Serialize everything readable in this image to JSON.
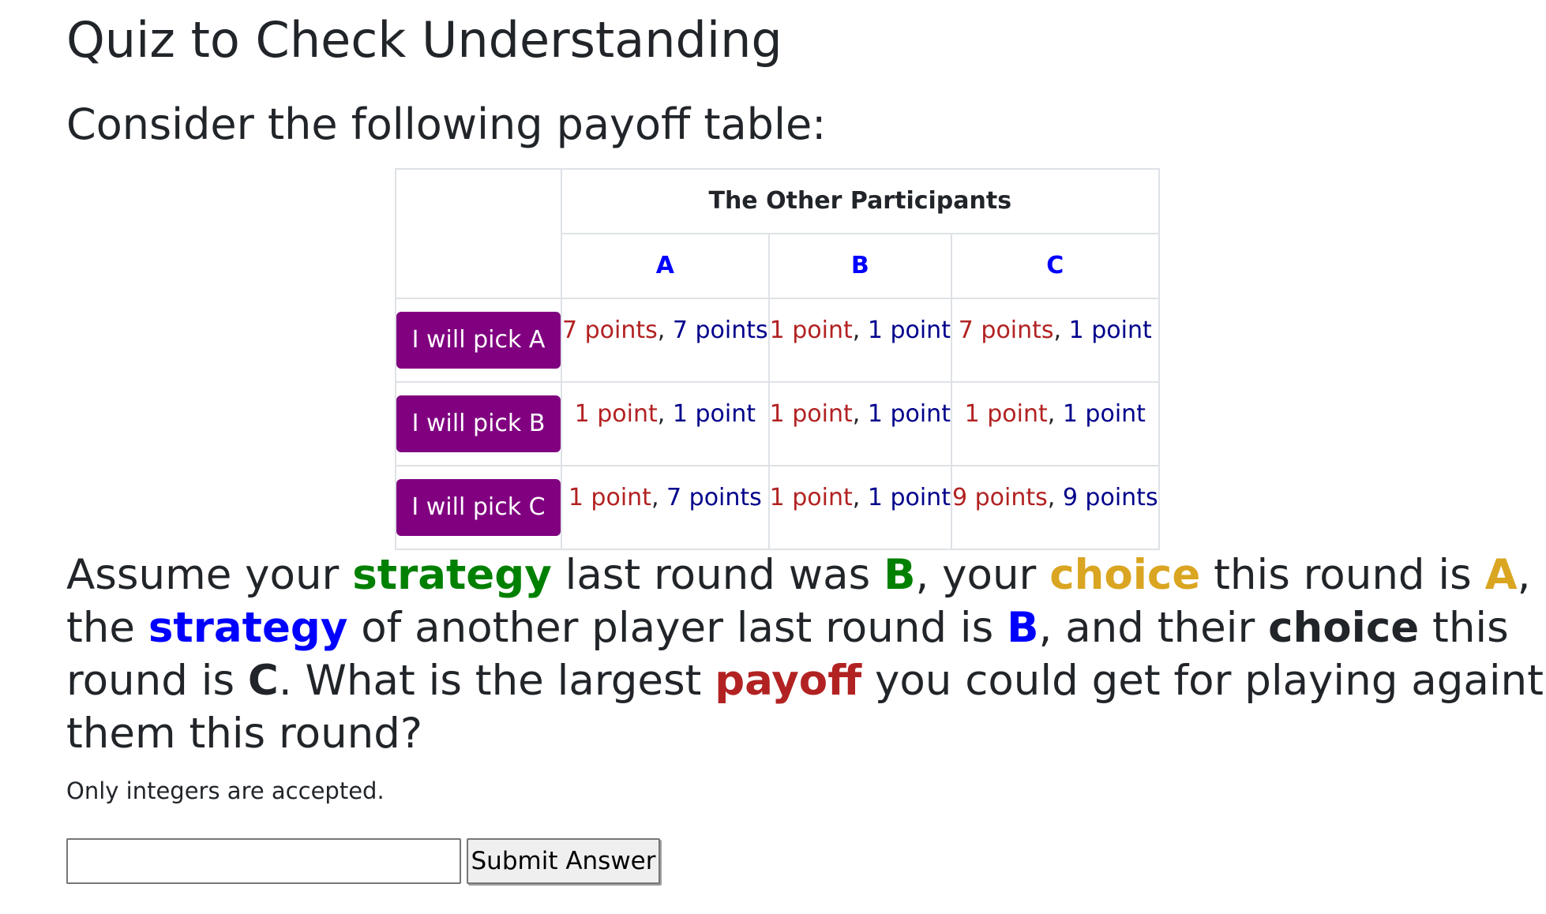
{
  "page": {
    "title": "Quiz to Check Understanding",
    "subtitle": "Consider the following payoff table:"
  },
  "table": {
    "group_header": "The Other Participants",
    "columns": [
      "A",
      "B",
      "C"
    ],
    "rows": [
      {
        "button": "I will pick A",
        "cells": [
          {
            "mine": "7 points",
            "theirs": "7 points"
          },
          {
            "mine": "1 point",
            "theirs": "1 point"
          },
          {
            "mine": "7 points",
            "theirs": "1 point"
          }
        ]
      },
      {
        "button": "I will pick B",
        "cells": [
          {
            "mine": "1 point",
            "theirs": "1 point"
          },
          {
            "mine": "1 point",
            "theirs": "1 point"
          },
          {
            "mine": "1 point",
            "theirs": "1 point"
          }
        ]
      },
      {
        "button": "I will pick C",
        "cells": [
          {
            "mine": "1 point",
            "theirs": "7 points"
          },
          {
            "mine": "1 point",
            "theirs": "1 point"
          },
          {
            "mine": "9 points",
            "theirs": "9 points"
          }
        ]
      }
    ],
    "separator": ", "
  },
  "question": {
    "t1": "Assume your ",
    "k1": "strategy",
    "t2": " last round was ",
    "k2": "B",
    "t3": ", your ",
    "k3": "choice",
    "t4": " this round is ",
    "k4": "A",
    "t5": ", the ",
    "k5": "strategy",
    "t6": " of another player last round is ",
    "k6": "B",
    "t7": ", and their ",
    "k7": "choice",
    "t8": " this round is ",
    "k8": "C",
    "t9": ". What is the largest ",
    "k9": "payoff",
    "t10": " you could get for playing againt them this round?"
  },
  "note": "Only integers are accepted.",
  "answer": {
    "value": "",
    "submit_label": "Submit Answer"
  },
  "colors": {
    "button_purple": "#800080",
    "my_payoff": "#b22222",
    "their_payoff": "#00008b",
    "column_header": "#0000ff",
    "my_strategy": "#008000",
    "my_choice": "#daa520",
    "their_strategy": "#0000ff",
    "payoff_word": "#b22222"
  }
}
